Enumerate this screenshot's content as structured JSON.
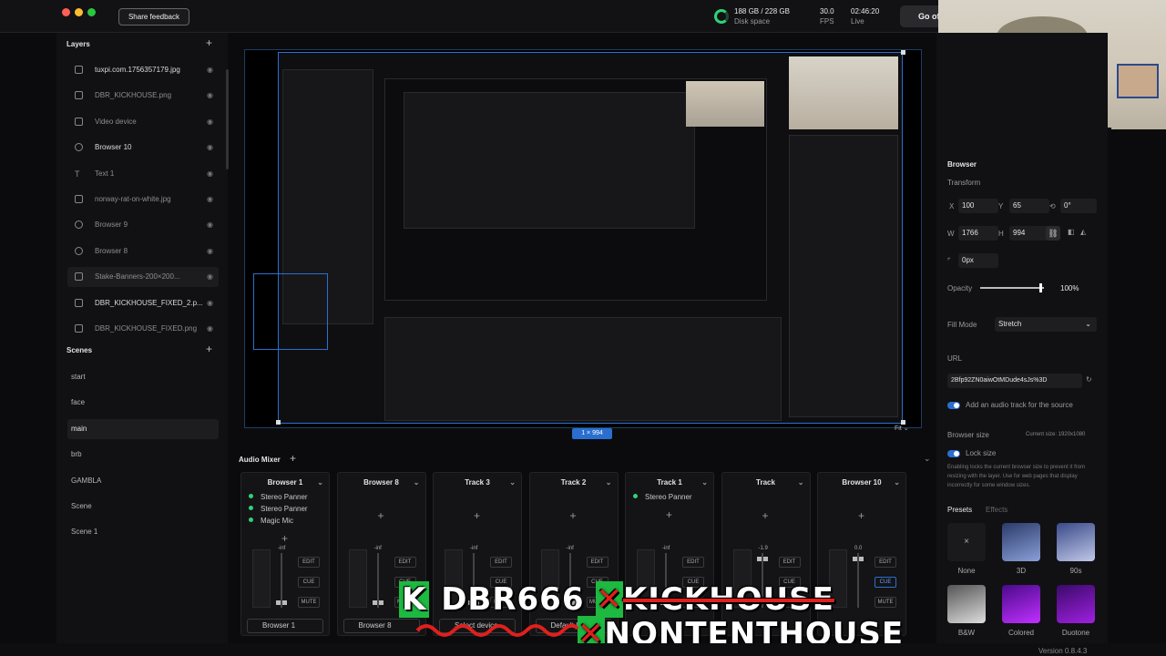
{
  "topbar": {
    "feedback": "Share feedback",
    "disk_value": "188 GB / 228 GB",
    "disk_label": "Disk space",
    "fps_value": "30.0",
    "fps_label": "FPS",
    "time_value": "02:46:20",
    "time_label": "Live",
    "go_live": "Go of"
  },
  "layers": {
    "title": "Layers",
    "items": [
      {
        "label": "tuxpi.com.1756357179.jpg",
        "icon": "image-icon",
        "active": true
      },
      {
        "label": "DBR_KICKHOUSE.png",
        "icon": "image-icon",
        "active": false
      },
      {
        "label": "Video device",
        "icon": "image-icon",
        "active": false
      },
      {
        "label": "Browser 10",
        "icon": "globe-icon",
        "active": true
      },
      {
        "label": "Text 1",
        "icon": "text-icon",
        "active": false
      },
      {
        "label": "norway-rat-on-white.jpg",
        "icon": "image-icon",
        "active": false
      },
      {
        "label": "Browser 9",
        "icon": "globe-icon",
        "active": false
      },
      {
        "label": "Browser 8",
        "icon": "globe-icon",
        "active": false
      },
      {
        "label": "Stake-Banners-200×200...",
        "icon": "image-icon",
        "active": false
      },
      {
        "label": "DBR_KICKHOUSE_FIXED_2.p...",
        "icon": "image-icon",
        "active": true
      },
      {
        "label": "DBR_KICKHOUSE_FIXED.png",
        "icon": "image-icon",
        "active": false
      }
    ]
  },
  "scenes": {
    "title": "Scenes",
    "items": [
      "start",
      "face",
      "main",
      "brb",
      "GAMBLA",
      "Scene",
      "Scene 1"
    ],
    "selected": "main"
  },
  "preview": {
    "badge": "1 × 994",
    "fit": "Fit"
  },
  "right": {
    "section": "Browser",
    "transform": "Transform",
    "x": "100",
    "y": "65",
    "rot": "0°",
    "w": "1766",
    "h": "994",
    "corner": "0px",
    "opacity_label": "Opacity",
    "opacity": "100%",
    "fill_label": "Fill Mode",
    "fill_value": "Stretch",
    "url_label": "URL",
    "url": "2Bfp92ZN0aiwOtMDude4sJs%3D",
    "audio_track": "Add an audio track for the source",
    "browser_size": "Browser size",
    "current_size": "Current size: 1920x1080",
    "lock_size": "Lock size",
    "lock_desc": "Enabling locks the current browser size to prevent it from resizing with the layer. Use for web pages that display incorrectly for some window sizes.",
    "presets_tab": "Presets",
    "effects_tab": "Effects",
    "presets": [
      {
        "label": "None"
      },
      {
        "label": "3D"
      },
      {
        "label": "90s"
      },
      {
        "label": "B&W"
      },
      {
        "label": "Colored"
      },
      {
        "label": "Duotone"
      }
    ]
  },
  "mixer": {
    "title": "Audio Mixer",
    "strips": [
      {
        "name": "Browser 1",
        "filters": [
          "Stereo Panner",
          "Stereo Panner",
          "Magic Mic"
        ],
        "level": "-inf",
        "source": "Browser 1"
      },
      {
        "name": "Browser 8",
        "filters": [],
        "level": "-inf",
        "source": "Browser 8"
      },
      {
        "name": "Track 3",
        "filters": [],
        "level": "-inf",
        "source": "Select device"
      },
      {
        "name": "Track 2",
        "filters": [],
        "level": "-inf",
        "source": "Default Inp"
      },
      {
        "name": "Track 1",
        "filters": [
          "Stereo Panner"
        ],
        "level": "-inf",
        "source": ""
      },
      {
        "name": "Track",
        "filters": [],
        "level": "-1.9",
        "source": ""
      },
      {
        "name": "Browser 10",
        "filters": [],
        "level": "0.0",
        "source": ""
      }
    ],
    "edit": "EDIT",
    "cue": "CUE",
    "mute": "MUTE"
  },
  "overlay": {
    "k": "K",
    "line1": "DBR666",
    "strike": "KICKHOUSE",
    "line2": "NONTENTHOUSE"
  },
  "version": "Version 0.8.4.3",
  "colors": {
    "accent": "#2a6fd0",
    "green": "#2fd27a",
    "brand_green": "#1db940",
    "strike_red": "#e0201c"
  }
}
